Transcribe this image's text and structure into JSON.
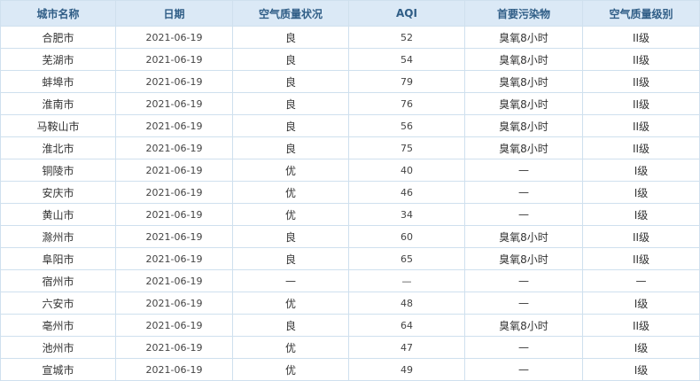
{
  "table": {
    "headers": {
      "city": "城市名称",
      "date": "日期",
      "status": "空气质量状况",
      "aqi": "AQI",
      "pollutant": "首要污染物",
      "level": "空气质量级别"
    },
    "rows": [
      {
        "city": "合肥市",
        "date": "2021-06-19",
        "status": "良",
        "aqi": "52",
        "pollutant": "臭氧8小时",
        "level": "II级"
      },
      {
        "city": "芜湖市",
        "date": "2021-06-19",
        "status": "良",
        "aqi": "54",
        "pollutant": "臭氧8小时",
        "level": "II级"
      },
      {
        "city": "蚌埠市",
        "date": "2021-06-19",
        "status": "良",
        "aqi": "79",
        "pollutant": "臭氧8小时",
        "level": "II级"
      },
      {
        "city": "淮南市",
        "date": "2021-06-19",
        "status": "良",
        "aqi": "76",
        "pollutant": "臭氧8小时",
        "level": "II级"
      },
      {
        "city": "马鞍山市",
        "date": "2021-06-19",
        "status": "良",
        "aqi": "56",
        "pollutant": "臭氧8小时",
        "level": "II级"
      },
      {
        "city": "淮北市",
        "date": "2021-06-19",
        "status": "良",
        "aqi": "75",
        "pollutant": "臭氧8小时",
        "level": "II级"
      },
      {
        "city": "铜陵市",
        "date": "2021-06-19",
        "status": "优",
        "aqi": "40",
        "pollutant": "—",
        "level": "I级"
      },
      {
        "city": "安庆市",
        "date": "2021-06-19",
        "status": "优",
        "aqi": "46",
        "pollutant": "—",
        "level": "I级"
      },
      {
        "city": "黄山市",
        "date": "2021-06-19",
        "status": "优",
        "aqi": "34",
        "pollutant": "—",
        "level": "I级"
      },
      {
        "city": "滁州市",
        "date": "2021-06-19",
        "status": "良",
        "aqi": "60",
        "pollutant": "臭氧8小时",
        "level": "II级"
      },
      {
        "city": "阜阳市",
        "date": "2021-06-19",
        "status": "良",
        "aqi": "65",
        "pollutant": "臭氧8小时",
        "level": "II级"
      },
      {
        "city": "宿州市",
        "date": "2021-06-19",
        "status": "—",
        "aqi": "—",
        "pollutant": "—",
        "level": "—"
      },
      {
        "city": "六安市",
        "date": "2021-06-19",
        "status": "优",
        "aqi": "48",
        "pollutant": "—",
        "level": "I级"
      },
      {
        "city": "亳州市",
        "date": "2021-06-19",
        "status": "良",
        "aqi": "64",
        "pollutant": "臭氧8小时",
        "level": "II级"
      },
      {
        "city": "池州市",
        "date": "2021-06-19",
        "status": "优",
        "aqi": "47",
        "pollutant": "—",
        "level": "I级"
      },
      {
        "city": "宣城市",
        "date": "2021-06-19",
        "status": "优",
        "aqi": "49",
        "pollutant": "—",
        "level": "I级"
      }
    ]
  }
}
